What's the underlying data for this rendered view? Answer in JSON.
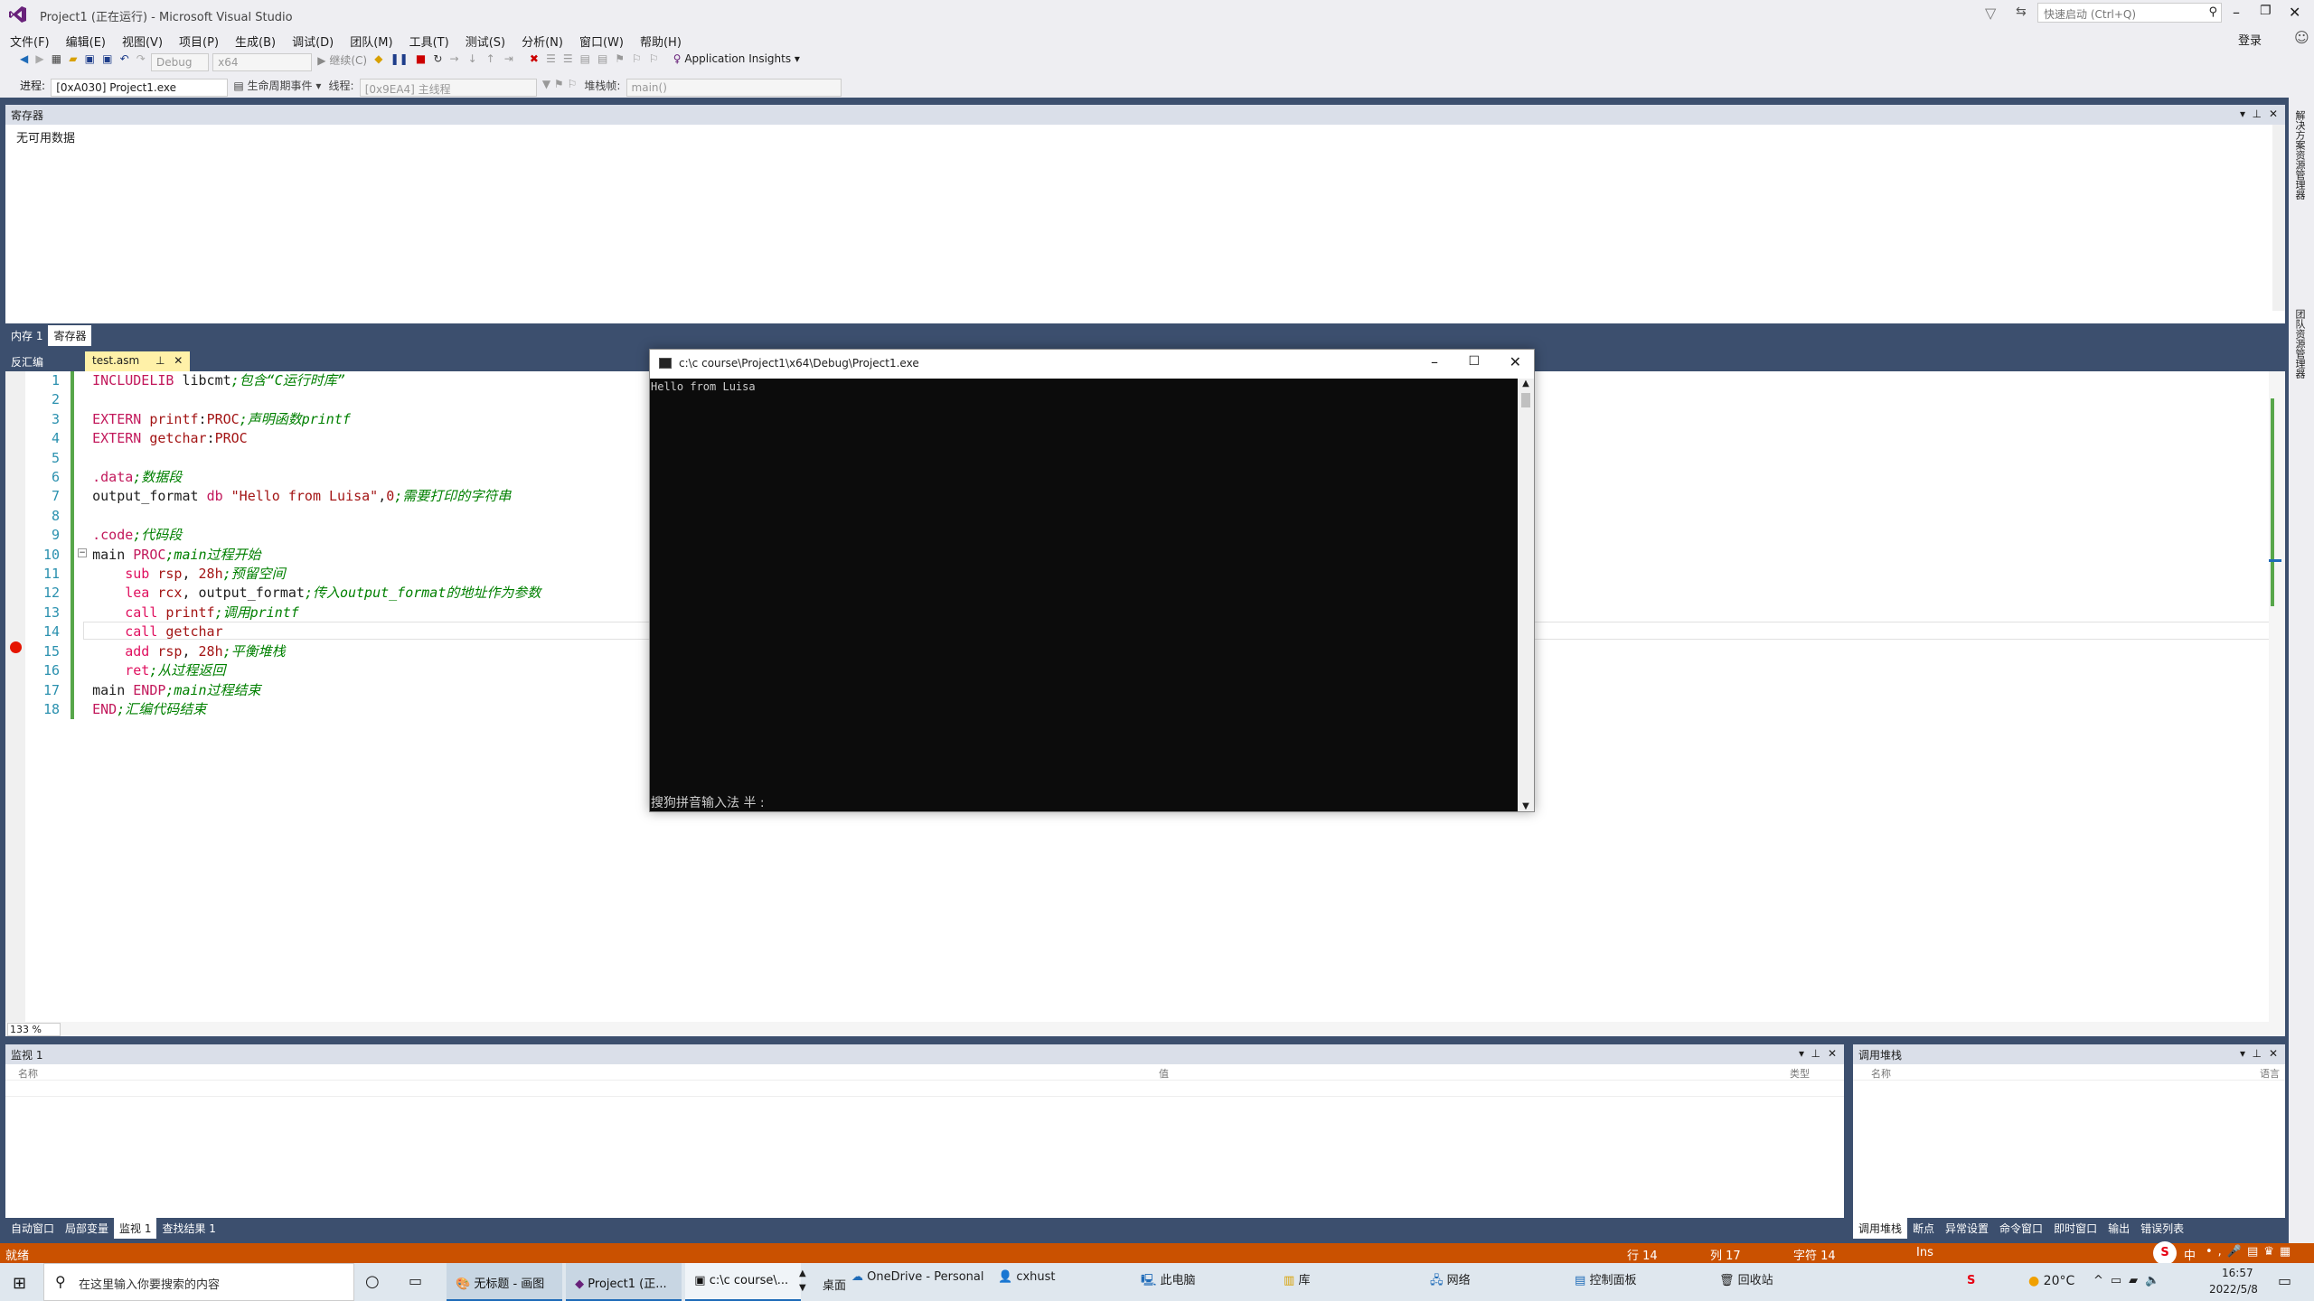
{
  "window": {
    "title": "Project1 (正在运行) - Microsoft Visual Studio",
    "quick_launch_placeholder": "快速启动 (Ctrl+Q)",
    "login": "登录"
  },
  "menu": [
    "文件(F)",
    "编辑(E)",
    "视图(V)",
    "项目(P)",
    "生成(B)",
    "调试(D)",
    "团队(M)",
    "工具(T)",
    "测试(S)",
    "分析(N)",
    "窗口(W)",
    "帮助(H)"
  ],
  "toolbar": {
    "config": "Debug",
    "platform": "x64",
    "continue": "继续(C)",
    "app_insights": "Application Insights"
  },
  "debug_bar": {
    "process_label": "进程:",
    "process_value": "[0xA030] Project1.exe",
    "lifecycle": "生命周期事件",
    "thread_label": "线程:",
    "thread_value": "[0x9EA4] 主线程",
    "stack_label": "堆栈帧:",
    "stack_value": "main()"
  },
  "registers_panel": {
    "title": "寄存器",
    "content": "无可用数据",
    "tabs": [
      "内存 1",
      "寄存器"
    ]
  },
  "right_rail": {
    "items": [
      "解决方案资源管理器",
      "团队资源管理器"
    ]
  },
  "editor": {
    "side_tab": "反汇编",
    "file_tab": "test.asm",
    "zoom": "133 %",
    "lines": [
      {
        "n": "1",
        "parts": [
          [
            "dir",
            "INCLUDELIB "
          ],
          [
            "t",
            "libcmt"
          ],
          [
            "cm",
            ";包含“C运行时库”"
          ]
        ]
      },
      {
        "n": "2",
        "parts": []
      },
      {
        "n": "3",
        "parts": [
          [
            "dir",
            "EXTERN "
          ],
          [
            "kw",
            "printf"
          ],
          [
            "t",
            ":"
          ],
          [
            "kw",
            "PROC"
          ],
          [
            "cm",
            ";声明函数printf"
          ]
        ]
      },
      {
        "n": "4",
        "parts": [
          [
            "dir",
            "EXTERN "
          ],
          [
            "kw",
            "getchar"
          ],
          [
            "t",
            ":"
          ],
          [
            "kw",
            "PROC"
          ]
        ]
      },
      {
        "n": "5",
        "parts": []
      },
      {
        "n": "6",
        "parts": [
          [
            "dir",
            ".data"
          ],
          [
            "cm",
            ";数据段"
          ]
        ]
      },
      {
        "n": "7",
        "parts": [
          [
            "t",
            "output_format "
          ],
          [
            "dir",
            "db "
          ],
          [
            "str",
            "\"Hello from Luisa\""
          ],
          [
            "t",
            ","
          ],
          [
            "kw",
            "0"
          ],
          [
            "cm",
            ";需要打印的字符串"
          ]
        ]
      },
      {
        "n": "8",
        "parts": []
      },
      {
        "n": "9",
        "parts": [
          [
            "dir",
            ".code"
          ],
          [
            "cm",
            ";代码段"
          ]
        ]
      },
      {
        "n": "10",
        "parts": [
          [
            "t",
            "main "
          ],
          [
            "dir",
            "PROC"
          ],
          [
            "cm",
            ";main过程开始"
          ]
        ]
      },
      {
        "n": "11",
        "parts": [
          [
            "t",
            "    "
          ],
          [
            "kw2",
            "sub "
          ],
          [
            "kw",
            "rsp"
          ],
          [
            "t",
            ", "
          ],
          [
            "kw",
            "28h"
          ],
          [
            "cm",
            ";预留空间"
          ]
        ]
      },
      {
        "n": "12",
        "parts": [
          [
            "t",
            "    "
          ],
          [
            "kw2",
            "lea "
          ],
          [
            "kw",
            "rcx"
          ],
          [
            "t",
            ", output_format"
          ],
          [
            "cm",
            ";传入output_format的地址作为参数"
          ]
        ]
      },
      {
        "n": "13",
        "parts": [
          [
            "t",
            "    "
          ],
          [
            "kw2",
            "call "
          ],
          [
            "kw",
            "printf"
          ],
          [
            "cm",
            ";调用printf"
          ]
        ]
      },
      {
        "n": "14",
        "parts": [
          [
            "t",
            "    "
          ],
          [
            "kw2",
            "call "
          ],
          [
            "kw",
            "getchar"
          ]
        ]
      },
      {
        "n": "15",
        "parts": [
          [
            "t",
            "    "
          ],
          [
            "kw2",
            "add "
          ],
          [
            "kw",
            "rsp"
          ],
          [
            "t",
            ", "
          ],
          [
            "kw",
            "28h"
          ],
          [
            "cm",
            ";平衡堆栈"
          ]
        ]
      },
      {
        "n": "16",
        "parts": [
          [
            "t",
            "    "
          ],
          [
            "kw2",
            "ret"
          ],
          [
            "cm",
            ";从过程返回"
          ]
        ]
      },
      {
        "n": "17",
        "parts": [
          [
            "t",
            "main "
          ],
          [
            "dir",
            "ENDP"
          ],
          [
            "cm",
            ";main过程结束"
          ]
        ]
      },
      {
        "n": "18",
        "parts": [
          [
            "dir",
            "END"
          ],
          [
            "cm",
            ";汇编代码结束"
          ]
        ]
      }
    ]
  },
  "console": {
    "title": "c:\\c course\\Project1\\x64\\Debug\\Project1.exe",
    "output": "Hello from Luisa",
    "ime": "搜狗拼音输入法 半 :"
  },
  "watch": {
    "title": "监视 1",
    "col_name": "名称",
    "col_value": "值",
    "col_type": "类型",
    "tabs": [
      "自动窗口",
      "局部变量",
      "监视 1",
      "查找结果 1"
    ]
  },
  "callstack": {
    "title": "调用堆栈",
    "col_name": "名称",
    "col_lang": "语言",
    "tabs": [
      "调用堆栈",
      "断点",
      "异常设置",
      "命令窗口",
      "即时窗口",
      "输出",
      "错误列表"
    ]
  },
  "status": {
    "ready": "就绪",
    "row": "行 14",
    "col": "列 17",
    "char": "字符 14",
    "ins": "Ins"
  },
  "taskbar": {
    "search": "在这里输入你要搜索的内容",
    "apps": [
      "无标题 - 画图",
      "Project1 (正...",
      "c:\\c course\\..."
    ],
    "desktop": "桌面",
    "links": [
      "OneDrive - Personal",
      "cxhust",
      "此电脑",
      "库",
      "网络",
      "控制面板",
      "回收站"
    ],
    "weather": "20°C",
    "time": "16:57",
    "date": "2022/5/8",
    "ime": "中"
  }
}
